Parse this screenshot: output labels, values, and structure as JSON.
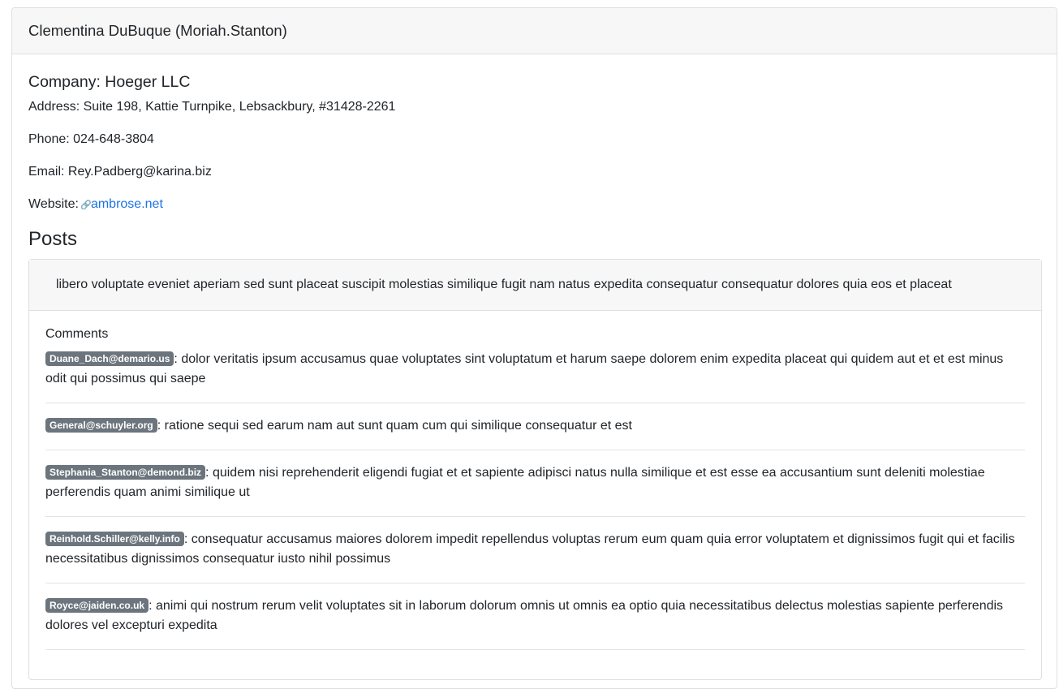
{
  "user": {
    "header": "Clementina DuBuque (Moriah.Stanton)",
    "company": "Company: Hoeger LLC",
    "address": "Address: Suite 198, Kattie Turnpike, Lebsackbury, #31428-2261",
    "phone": "Phone: 024-648-3804",
    "email": "Email: Rey.Padberg@karina.biz",
    "website_label": "Website:",
    "website_link": "ambrose.net",
    "website_icon": "link-icon"
  },
  "posts_title": "Posts",
  "post": {
    "title": "libero voluptate eveniet aperiam sed sunt placeat suscipit molestias similique fugit nam natus expedita consequatur consequatur dolores quia eos et placeat",
    "comments_label": "Comments",
    "comments": [
      {
        "email": "Duane_Dach@demario.us",
        "body": ": dolor veritatis ipsum accusamus quae voluptates sint voluptatum et harum saepe dolorem enim expedita placeat qui quidem aut et et est minus odit qui possimus qui saepe"
      },
      {
        "email": "General@schuyler.org",
        "body": ": ratione sequi sed earum nam aut sunt quam cum qui similique consequatur et est"
      },
      {
        "email": "Stephania_Stanton@demond.biz",
        "body": ": quidem nisi reprehenderit eligendi fugiat et et sapiente adipisci natus nulla similique et est esse ea accusantium sunt deleniti molestiae perferendis quam animi similique ut"
      },
      {
        "email": "Reinhold.Schiller@kelly.info",
        "body": ": consequatur accusamus maiores dolorem impedit repellendus voluptas rerum eum quam quia error voluptatem et dignissimos fugit qui et facilis necessitatibus dignissimos consequatur iusto nihil possimus"
      },
      {
        "email": "Royce@jaiden.co.uk",
        "body": ": animi qui nostrum rerum velit voluptates sit in laborum dolorum omnis ut omnis ea optio quia necessitatibus delectus molestias sapiente perferendis dolores vel excepturi expedita"
      }
    ]
  }
}
